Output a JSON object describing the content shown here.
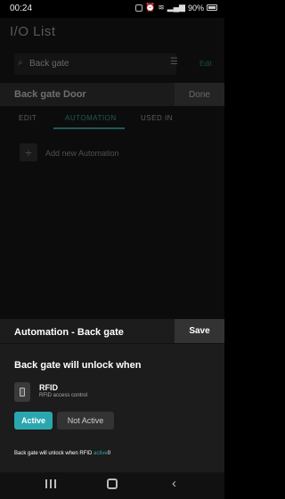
{
  "status_bar": {
    "time": "00:24",
    "battery": "90%"
  },
  "background_page": {
    "title": "I/O List",
    "search_value": "Back gate",
    "edit_label": "Edit",
    "door_title": "Back gate Door",
    "done_label": "Done",
    "tabs": [
      {
        "label": "EDIT",
        "active": false
      },
      {
        "label": "AUTOMATION",
        "active": true
      },
      {
        "label": "USED IN",
        "active": false
      }
    ],
    "add_automation_label": "Add new Automation"
  },
  "sheet": {
    "title": "Automation - Back gate",
    "save_label": "Save",
    "unlock_title": "Back gate will unlock when",
    "trigger": {
      "icon": "rfid-reader-icon",
      "label": "RFID",
      "sublabel": "RFID access control"
    },
    "state_options": [
      {
        "label": "Active",
        "selected": true
      },
      {
        "label": "Not Active",
        "selected": false
      }
    ],
    "summary_prefix": "Back gate will unlock when RFID ",
    "summary_state": "active",
    "summary_suffix": "0"
  },
  "colors": {
    "accent": "#2aa7ae",
    "sheet_bg": "#1c1c1c",
    "dim_bg": "#0c0c0c"
  }
}
